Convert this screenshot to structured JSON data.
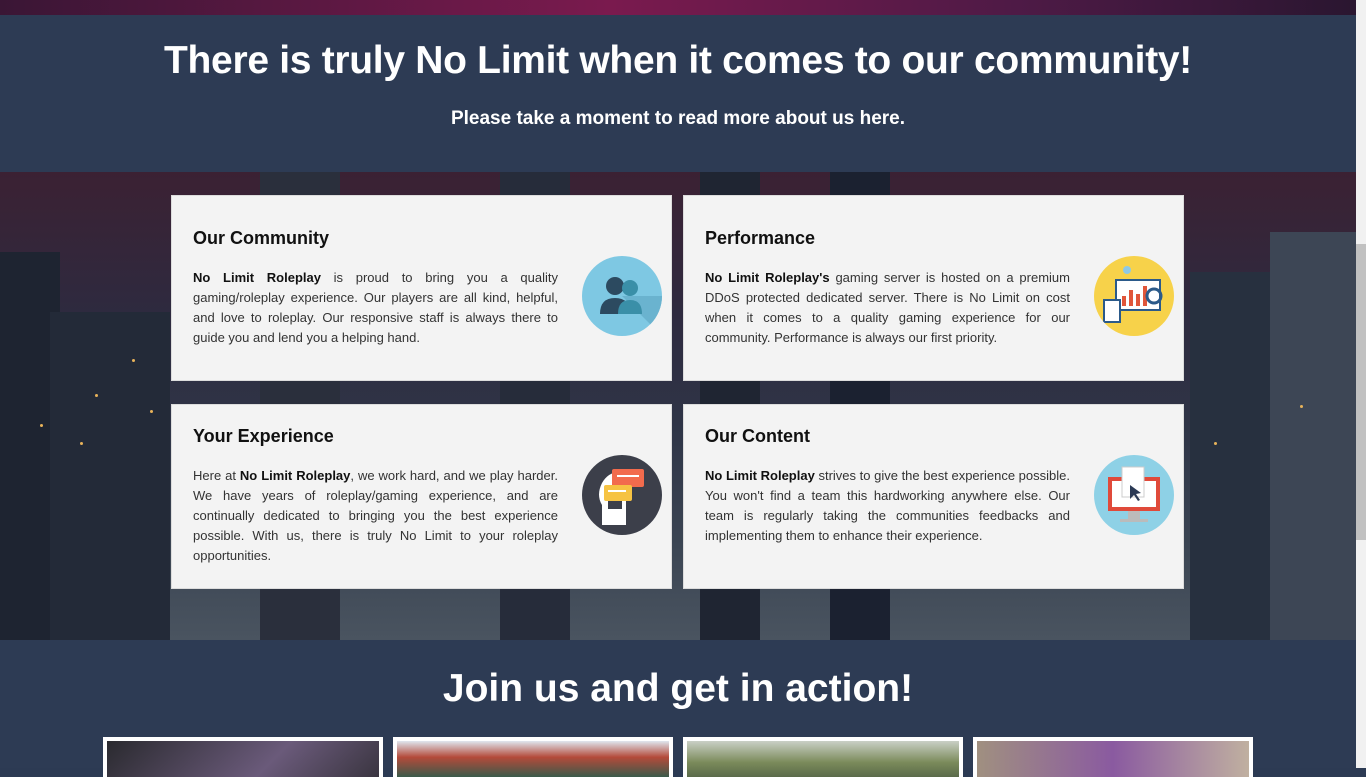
{
  "intro": {
    "title": "There is truly No Limit when it comes to our community!",
    "subtitle": "Please take a moment to read more about us here."
  },
  "cards": [
    {
      "title": "Our Community",
      "text_bold": "No Limit Roleplay",
      "text_rest": " is proud to bring you a quality gaming/roleplay experience. Our players are all kind, helpful, and love to roleplay. Our responsive staff is always there to guide you and lend you a helping hand.",
      "icon": "users-icon"
    },
    {
      "title": "Performance",
      "text_bold": "No Limit Roleplay's",
      "text_rest": " gaming server is hosted on a premium DDoS protected dedicated server. There is No Limit on cost when it comes to a quality gaming experience for our community. Performance is always our first priority.",
      "icon": "analytics-dashboard-icon"
    },
    {
      "title": "Your Experience",
      "text_pre": "Here at ",
      "text_bold": "No Limit Roleplay",
      "text_rest": ", we work hard, and we play harder. We have years of roleplay/gaming experience, and are continually dedicated to bringing you the best experience possible. With us, there is truly No Limit to your roleplay opportunities.",
      "icon": "head-chat-bubbles-icon"
    },
    {
      "title": "Our Content",
      "text_bold": "No Limit Roleplay",
      "text_rest": " strives to give the best experience possible. You won't find a team this hardworking anywhere else. Our team is regularly taking the communities feedbacks and implementing them to enhance their experience.",
      "icon": "monitor-document-icon"
    }
  ],
  "join": {
    "title": "Join us and get in action!"
  },
  "colors": {
    "section_bg": "#2d3b54",
    "card_bg": "#f3f3f3"
  }
}
